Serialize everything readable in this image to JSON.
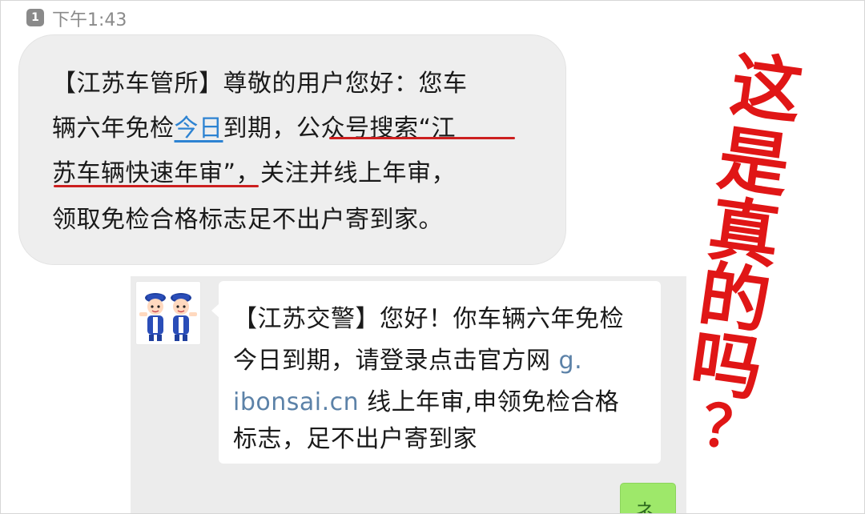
{
  "status": {
    "sim_badge": "1",
    "time": "下午1:43"
  },
  "sms": {
    "lines": [
      "【江苏车管所】尊敬的用户您好：您车",
      "辆六年免检",
      "今日",
      "到期，",
      "公众号搜索“江",
      "苏车辆快速年审”",
      "，关注并线上年审，",
      "领取免检合格标志足不出户寄到家。"
    ]
  },
  "wechat": {
    "lines": [
      "【江苏交警】您好！你车辆六年免检",
      "今日到期，请登录点击官方网 ",
      "g.",
      "ibonsai.cn",
      " 线上年审,申领免检合格",
      "标志，足不出户寄到家"
    ],
    "green_bubble_text": "ネ"
  },
  "annotation": {
    "chars": [
      "这",
      "是",
      "真",
      "的",
      "吗",
      "？"
    ]
  },
  "colors": {
    "annotation": "#e01616",
    "link": "#2d83d2",
    "underline": "#cc1f1f",
    "url": "#5c82a8"
  }
}
